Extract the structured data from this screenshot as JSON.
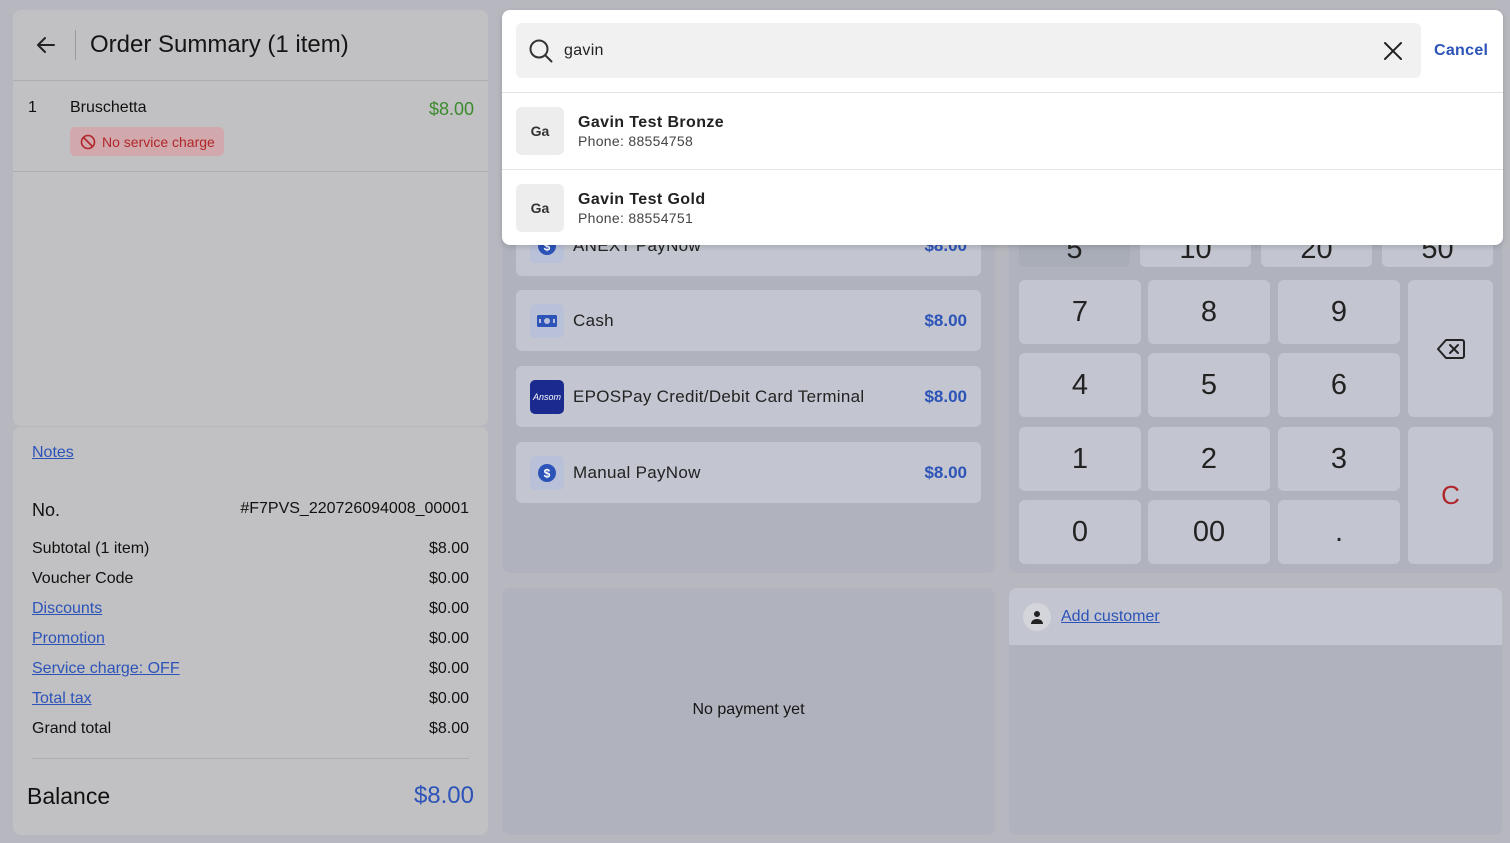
{
  "order_summary": {
    "title": "Order Summary (1 item)",
    "items": [
      {
        "qty": "1",
        "name": "Bruschetta",
        "price": "$8.00",
        "tag": "No service charge"
      }
    ],
    "notes_label": "Notes",
    "order_no_label": "No.",
    "order_no": "#F7PVS_220726094008_00001",
    "rows": [
      {
        "label": "Subtotal (1 item)",
        "value": "$8.00",
        "link": false
      },
      {
        "label": "Voucher Code",
        "value": "$0.00",
        "link": false
      },
      {
        "label": "Discounts",
        "value": "$0.00",
        "link": true
      },
      {
        "label": "Promotion",
        "value": "$0.00",
        "link": true
      },
      {
        "label": "Service charge: OFF",
        "value": "$0.00",
        "link": true
      },
      {
        "label": "Total tax",
        "value": "$0.00",
        "link": true
      },
      {
        "label": "Grand total",
        "value": "$8.00",
        "link": false
      }
    ],
    "balance_label": "Balance",
    "balance": "$8.00"
  },
  "payment_methods": [
    {
      "label": "ANEXT PayNow",
      "amount": "$8.00",
      "icon": "dollar-circle-icon"
    },
    {
      "label": "Cash",
      "amount": "$8.00",
      "icon": "cash-icon"
    },
    {
      "label": "EPOSPay Credit/Debit Card Terminal",
      "amount": "$8.00",
      "icon": "card-terminal-logo",
      "icon_text": "Ansom"
    },
    {
      "label": "Manual PayNow",
      "amount": "$8.00",
      "icon": "dollar-circle-icon"
    }
  ],
  "payments": {
    "empty_text": "No payment yet"
  },
  "keypad": {
    "quick_amounts": [
      "5",
      "10",
      "20",
      "50"
    ],
    "keys": [
      "7",
      "8",
      "9",
      "4",
      "5",
      "6",
      "1",
      "2",
      "3",
      "0",
      "00",
      "."
    ],
    "clear": "C"
  },
  "customer": {
    "add_label": "Add customer"
  },
  "search": {
    "query": "gavin",
    "cancel_label": "Cancel",
    "results": [
      {
        "initials": "Ga",
        "name": "Gavin Test Bronze",
        "phone": "Phone: 88554758"
      },
      {
        "initials": "Ga",
        "name": "Gavin Test Gold",
        "phone": "Phone: 88554751"
      }
    ]
  },
  "colors": {
    "accent": "#2c53b8",
    "price_green": "#3d8a2e",
    "warning_red": "#b0262a",
    "backdrop": "#b7b8bf"
  }
}
